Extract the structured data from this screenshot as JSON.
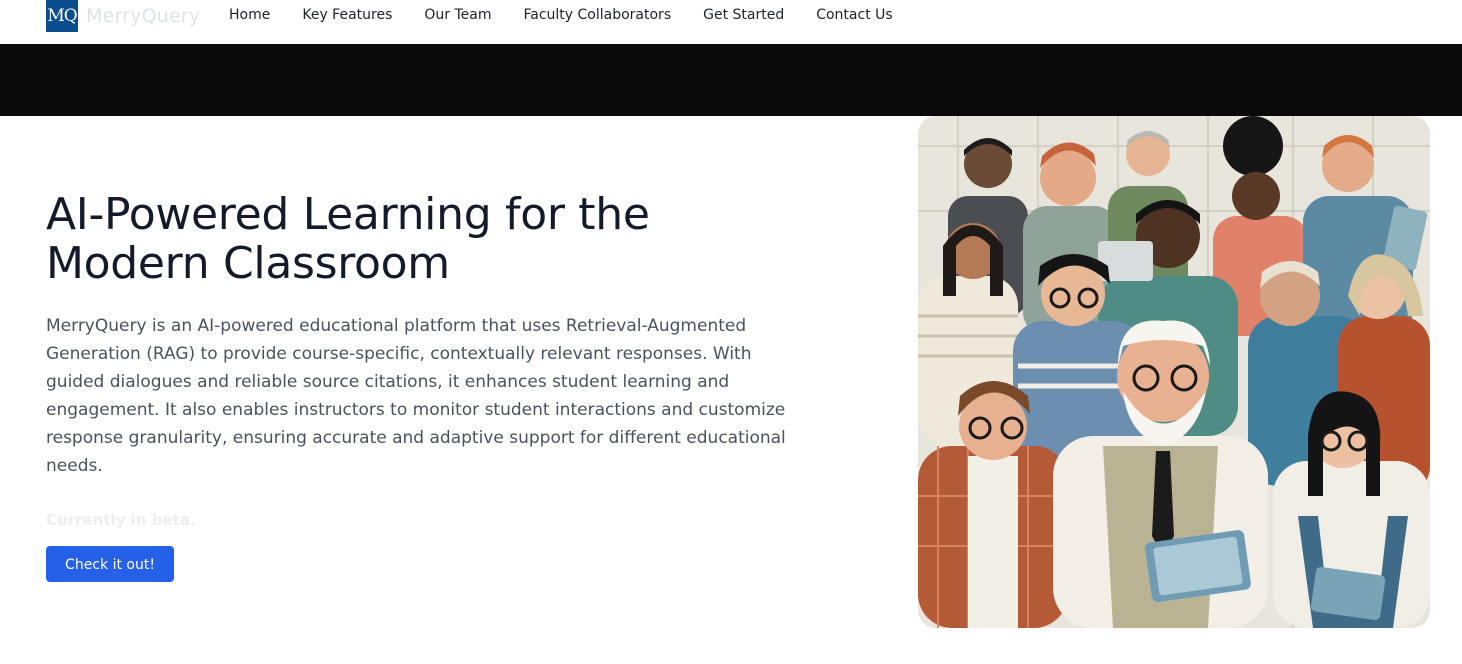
{
  "brand": {
    "logo_text": "MQ",
    "name": "MerryQuery"
  },
  "nav": {
    "items": [
      {
        "label": "Home"
      },
      {
        "label": "Key Features"
      },
      {
        "label": "Our Team"
      },
      {
        "label": "Faculty Collaborators"
      },
      {
        "label": "Get Started"
      },
      {
        "label": "Contact Us"
      }
    ]
  },
  "hero": {
    "title": "AI-Powered Learning for the Modern Classroom",
    "description": "MerryQuery is an AI-powered educational platform that uses Retrieval-Augmented Generation (RAG) to provide course-specific, contextually relevant responses. With guided dialogues and reliable source citations, it enhances student learning and engagement. It also enables instructors to monitor student interactions and customize response granularity, ensuring accurate and adaptive support for different educational needs.",
    "beta_note": "Currently in beta.",
    "cta_label": "Check it out!"
  },
  "colors": {
    "brand_logo": "#0b4d8f",
    "cta": "#2461e8",
    "dark_band": "#0a0a0a",
    "title": "#151a2b"
  }
}
